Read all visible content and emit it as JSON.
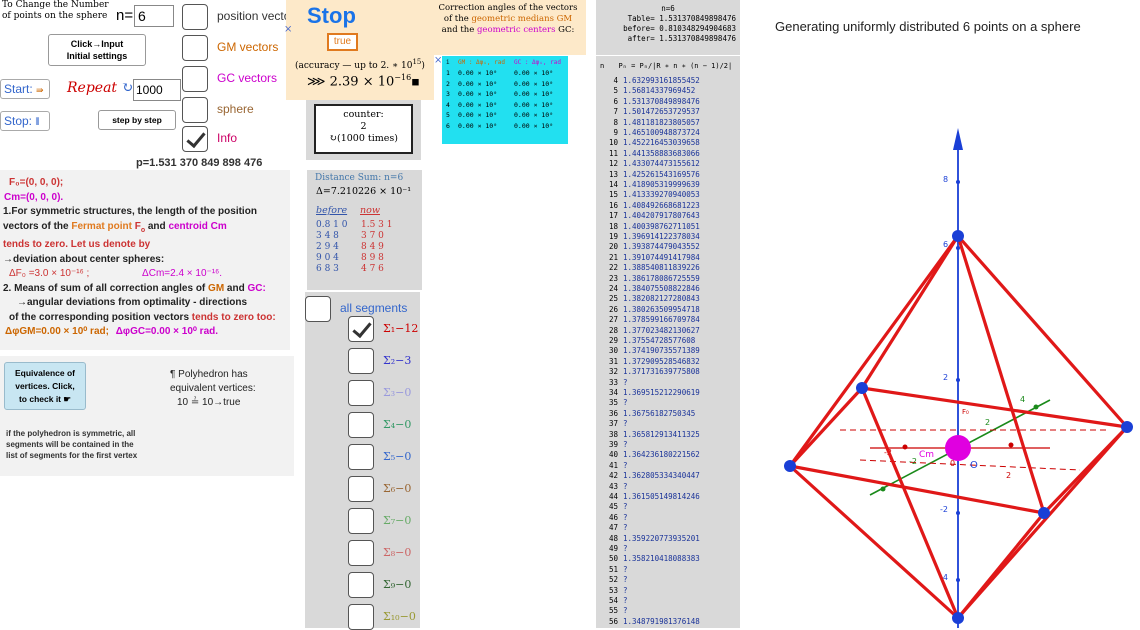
{
  "top": {
    "change_label_1": "To Change the Number",
    "change_label_2": "of points on the sphere",
    "n_label": "n=",
    "n_value": "6",
    "click_input_1": "Click→Input",
    "click_input_2": "Initial settings",
    "start_label": "Start:",
    "stop_label": "Stop:",
    "repeat_label": "Repeat",
    "repeat_value": "1000",
    "step_button": "step by step",
    "p_value": "p=1.531 370 849 898 476"
  },
  "toggles": [
    {
      "label": "position vectors",
      "color": "#333333",
      "checked": false
    },
    {
      "label": "GM vectors",
      "color": "#cc6600",
      "checked": false
    },
    {
      "label": "GC vectors",
      "color": "#cc00cc",
      "checked": false
    },
    {
      "label": "sphere",
      "color": "#996633",
      "checked": false
    },
    {
      "label": "Info",
      "color": "#cc0066",
      "checked": true
    }
  ],
  "stop_box": {
    "stop_text": "Stop",
    "true_text": "true",
    "accuracy_text": "(accuracy — up to  2. ∗ 10",
    "accuracy_exp": "15",
    "accuracy_close": ")",
    "value_text": "⋙ 2.39 × 10",
    "value_exp": "−16"
  },
  "counter": {
    "label": "counter:",
    "value": "2",
    "times": "(1000 times)"
  },
  "correction": {
    "line1": "Correction angles of the vectors",
    "line2_a": "of the ",
    "line2_b": "geometric medians GM",
    "line3_a": "and the ",
    "line3_b": "geometric centers",
    "line3_c": " GC:",
    "table_header": [
      "i",
      "GM : Δφᵢ, rad",
      "GC : Δφᵢ, rad"
    ],
    "table_rows": [
      [
        "1",
        "0.00 × 10⁰",
        "0.00 × 10⁰"
      ],
      [
        "2",
        "0.00 × 10⁰",
        "0.00 × 10⁰"
      ],
      [
        "3",
        "0.00 × 10⁰",
        "0.00 × 10⁰"
      ],
      [
        "4",
        "0.00 × 10⁰",
        "0.00 × 10⁰"
      ],
      [
        "5",
        "0.00 × 10⁰",
        "0.00 × 10⁰"
      ],
      [
        "6",
        "0.00 × 10⁰",
        "0.00 × 10⁰"
      ]
    ]
  },
  "table_stats": {
    "n": "n=6",
    "table": "Table= 1.531370849898476",
    "before": "before= 0.810348294904683",
    "after": "after= 1.531370849898476"
  },
  "pn_list": {
    "header_n": "n",
    "header_p": "Pₙ = Pₙ/|R ∗ n ∗ (n − 1)/2|",
    "rows": [
      [
        "4",
        "1.632993161855452"
      ],
      [
        "5",
        "1.56814337969452"
      ],
      [
        "6",
        "1.531370849898476"
      ],
      [
        "7",
        "1.501472653729537"
      ],
      [
        "8",
        "1.481181823805057"
      ],
      [
        "9",
        "1.465100948873724"
      ],
      [
        "10",
        "1.452216453039658"
      ],
      [
        "11",
        "1.441358883683066"
      ],
      [
        "12",
        "1.433074473155612"
      ],
      [
        "13",
        "1.425261543169576"
      ],
      [
        "14",
        "1.418905319999639"
      ],
      [
        "15",
        "1.413339270940053"
      ],
      [
        "16",
        "1.408492668681223"
      ],
      [
        "17",
        "1.404207917807643"
      ],
      [
        "18",
        "1.400398762711051"
      ],
      [
        "19",
        "1.396914122378034"
      ],
      [
        "20",
        "1.393874479043552"
      ],
      [
        "21",
        "1.391074491417984"
      ],
      [
        "22",
        "1.388540811839226"
      ],
      [
        "23",
        "1.386178086725559"
      ],
      [
        "24",
        "1.384075508822846"
      ],
      [
        "25",
        "1.382082127280843"
      ],
      [
        "26",
        "1.380263509954718"
      ],
      [
        "27",
        "1.378599166709784"
      ],
      [
        "28",
        "1.377023482130627"
      ],
      [
        "29",
        "1.37554728577608"
      ],
      [
        "30",
        "1.374190735571389"
      ],
      [
        "31",
        "1.372909528546832"
      ],
      [
        "32",
        "1.371731639775808"
      ],
      [
        "33",
        "?"
      ],
      [
        "34",
        "1.369515212290619"
      ],
      [
        "35",
        "?"
      ],
      [
        "36",
        "1.36756182750345"
      ],
      [
        "37",
        "?"
      ],
      [
        "38",
        "1.365812913411325"
      ],
      [
        "39",
        "?"
      ],
      [
        "40",
        "1.364236180221562"
      ],
      [
        "41",
        "?"
      ],
      [
        "42",
        "1.362805334340447"
      ],
      [
        "43",
        "?"
      ],
      [
        "44",
        "1.361505149814246"
      ],
      [
        "45",
        "?"
      ],
      [
        "46",
        "?"
      ],
      [
        "47",
        "?"
      ],
      [
        "48",
        "1.359220773935201"
      ],
      [
        "49",
        "?"
      ],
      [
        "50",
        "1.358210418088383"
      ],
      [
        "51",
        "?"
      ],
      [
        "52",
        "?"
      ],
      [
        "53",
        "?"
      ],
      [
        "54",
        "?"
      ],
      [
        "55",
        "?"
      ],
      [
        "56",
        "1.348791981376148"
      ]
    ]
  },
  "info": {
    "f0": "F₀=(0, 0, 0);",
    "cm": "Cm=(0, 0, 0).",
    "line1": "1.For symmetric structures, the length of the position",
    "line2_a": "vectors of the ",
    "line2_b": "Fermat point",
    "line2_c": " F",
    "line2_d": "o",
    "line2_e": " and ",
    "line2_f": "centroid Cm",
    "line3": "tends to zero. Let us denote by",
    "line4": "→deviation about center spheres:",
    "dev_f": "ΔF₀ =3.0 × 10⁻¹⁶ ;",
    "dev_cm": "ΔCm=2.4 × 10⁻¹⁶.",
    "line5_a": "2. Means of sum of all correction angles of ",
    "line5_b": "GM",
    "line5_c": " and ",
    "line5_d": "GC:",
    "line6": "→angular deviations from optimality - directions",
    "line7_a": "of the corresponding position vectors ",
    "line7_b": "tends to zero too:",
    "dgm": "ΔφGM=0.00 × 10⁰  rad;",
    "dgc": "ΔφGC=0.00 × 10⁰  rad."
  },
  "distance": {
    "title": "Distance Sum",
    "title_n": ": n=6",
    "delta": "Δ=7.210226 × 10⁻¹",
    "before": "before",
    "now": "now",
    "rows": [
      [
        "0.8 1 0",
        "1.5 3 1"
      ],
      [
        "3 4 8",
        "3 7 0"
      ],
      [
        "2 9 4",
        "8 4 9"
      ],
      [
        "9 0 4",
        "8 9 8"
      ],
      [
        "6 8 3",
        "4 7 6"
      ]
    ]
  },
  "equivalence": {
    "btn_1": "Equivalence of",
    "btn_2": "vertices. Click,",
    "btn_3": "to check it",
    "poly_1": "Polyhedron has",
    "poly_2": "equivalent vertices:",
    "poly_3": "10 ≟ 10→true",
    "note_1": "if the polyhedron is symmetric, all",
    "note_2": "segments will be contained in the",
    "note_3": "list of segments for the first vertex"
  },
  "segments": {
    "all_label": "all segments",
    "items": [
      {
        "label": "Σ₁−12",
        "color": "#cc0000",
        "checked": true
      },
      {
        "label": "Σ₂−3",
        "color": "#3333cc",
        "checked": false
      },
      {
        "label": "Σ₃−0",
        "color": "#9999dd",
        "checked": false
      },
      {
        "label": "Σ₄−0",
        "color": "#339966",
        "checked": false
      },
      {
        "label": "Σ₅−0",
        "color": "#3366cc",
        "checked": false
      },
      {
        "label": "Σ₆−0",
        "color": "#996633",
        "checked": false
      },
      {
        "label": "Σ₇−0",
        "color": "#66aa66",
        "checked": false
      },
      {
        "label": "Σ₈−0",
        "color": "#cc6666",
        "checked": false
      },
      {
        "label": "Σ₉−0",
        "color": "#336633",
        "checked": false
      },
      {
        "label": "Σ₁₀−0",
        "color": "#999933",
        "checked": false
      }
    ]
  },
  "graphics": {
    "caption": "Generating uniformly distributed  6 points on a sphere",
    "z_ticks": [
      "8",
      "6",
      "2",
      "-2",
      "-4"
    ],
    "axis_labels": [
      "2",
      "4",
      "-2",
      "-2",
      "0",
      "2"
    ],
    "point_labels": {
      "o": "O",
      "cm": "Cm",
      "f": "F₀"
    }
  }
}
